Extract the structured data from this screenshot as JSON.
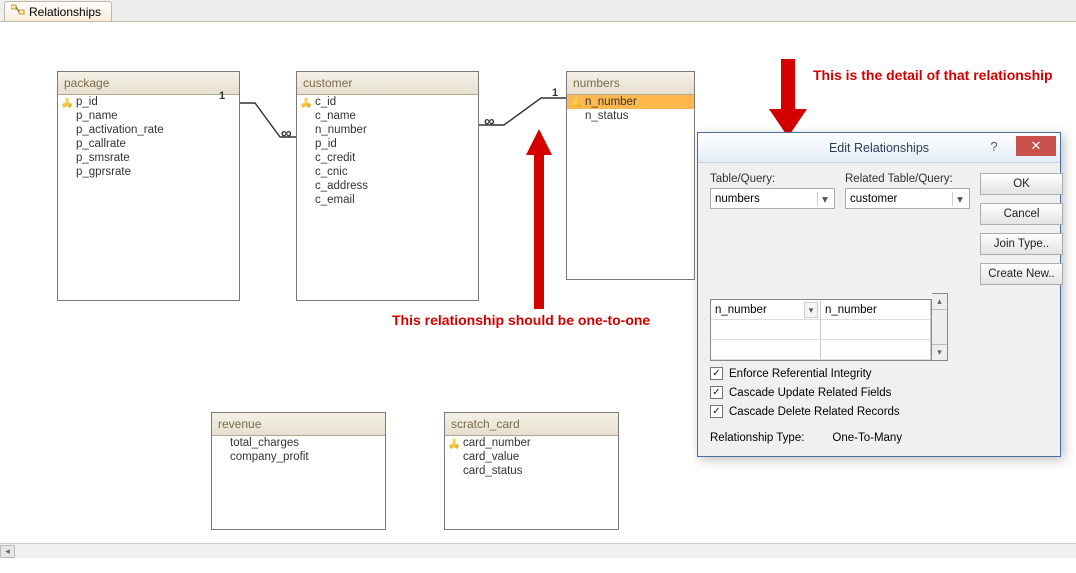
{
  "tab": {
    "label": "Relationships"
  },
  "tables": {
    "package": {
      "title": "package",
      "fields": [
        {
          "name": "p_id",
          "pk": true
        },
        {
          "name": "p_name"
        },
        {
          "name": "p_activation_rate"
        },
        {
          "name": "p_callrate"
        },
        {
          "name": "p_smsrate"
        },
        {
          "name": "p_gprsrate"
        }
      ]
    },
    "customer": {
      "title": "customer",
      "fields": [
        {
          "name": "c_id",
          "pk": true
        },
        {
          "name": "c_name"
        },
        {
          "name": "n_number"
        },
        {
          "name": "p_id"
        },
        {
          "name": "c_credit"
        },
        {
          "name": "c_cnic"
        },
        {
          "name": "c_address"
        },
        {
          "name": "c_email"
        }
      ]
    },
    "numbers": {
      "title": "numbers",
      "fields": [
        {
          "name": "n_number",
          "pk": true,
          "selected": true
        },
        {
          "name": "n_status"
        }
      ]
    },
    "revenue": {
      "title": "revenue",
      "fields": [
        {
          "name": "total_charges"
        },
        {
          "name": "company_profit"
        }
      ]
    },
    "scratch_card": {
      "title": "scratch_card",
      "fields": [
        {
          "name": "card_number",
          "pk": true
        },
        {
          "name": "card_value"
        },
        {
          "name": "card_status"
        }
      ]
    }
  },
  "cardinality": {
    "one": "1",
    "many": "∞"
  },
  "dialog": {
    "title": "Edit Relationships",
    "table_query_label": "Table/Query:",
    "related_table_query_label": "Related Table/Query:",
    "left_table": "numbers",
    "right_table": "customer",
    "left_field": "n_number",
    "right_field": "n_number",
    "enforce_label": "Enforce Referential Integrity",
    "cascade_update_label": "Cascade Update Related Fields",
    "cascade_delete_label": "Cascade Delete Related Records",
    "enforce": true,
    "cascade_update": true,
    "cascade_delete": true,
    "rel_type_label": "Relationship Type:",
    "rel_type_value": "One-To-Many",
    "buttons": {
      "ok": "OK",
      "cancel": "Cancel",
      "join": "Join Type..",
      "create": "Create New.."
    },
    "help": "?",
    "close": "✕"
  },
  "annotations": {
    "anno1": "This relationship should be one-to-one",
    "anno2": "This is the detail of that relationship"
  }
}
